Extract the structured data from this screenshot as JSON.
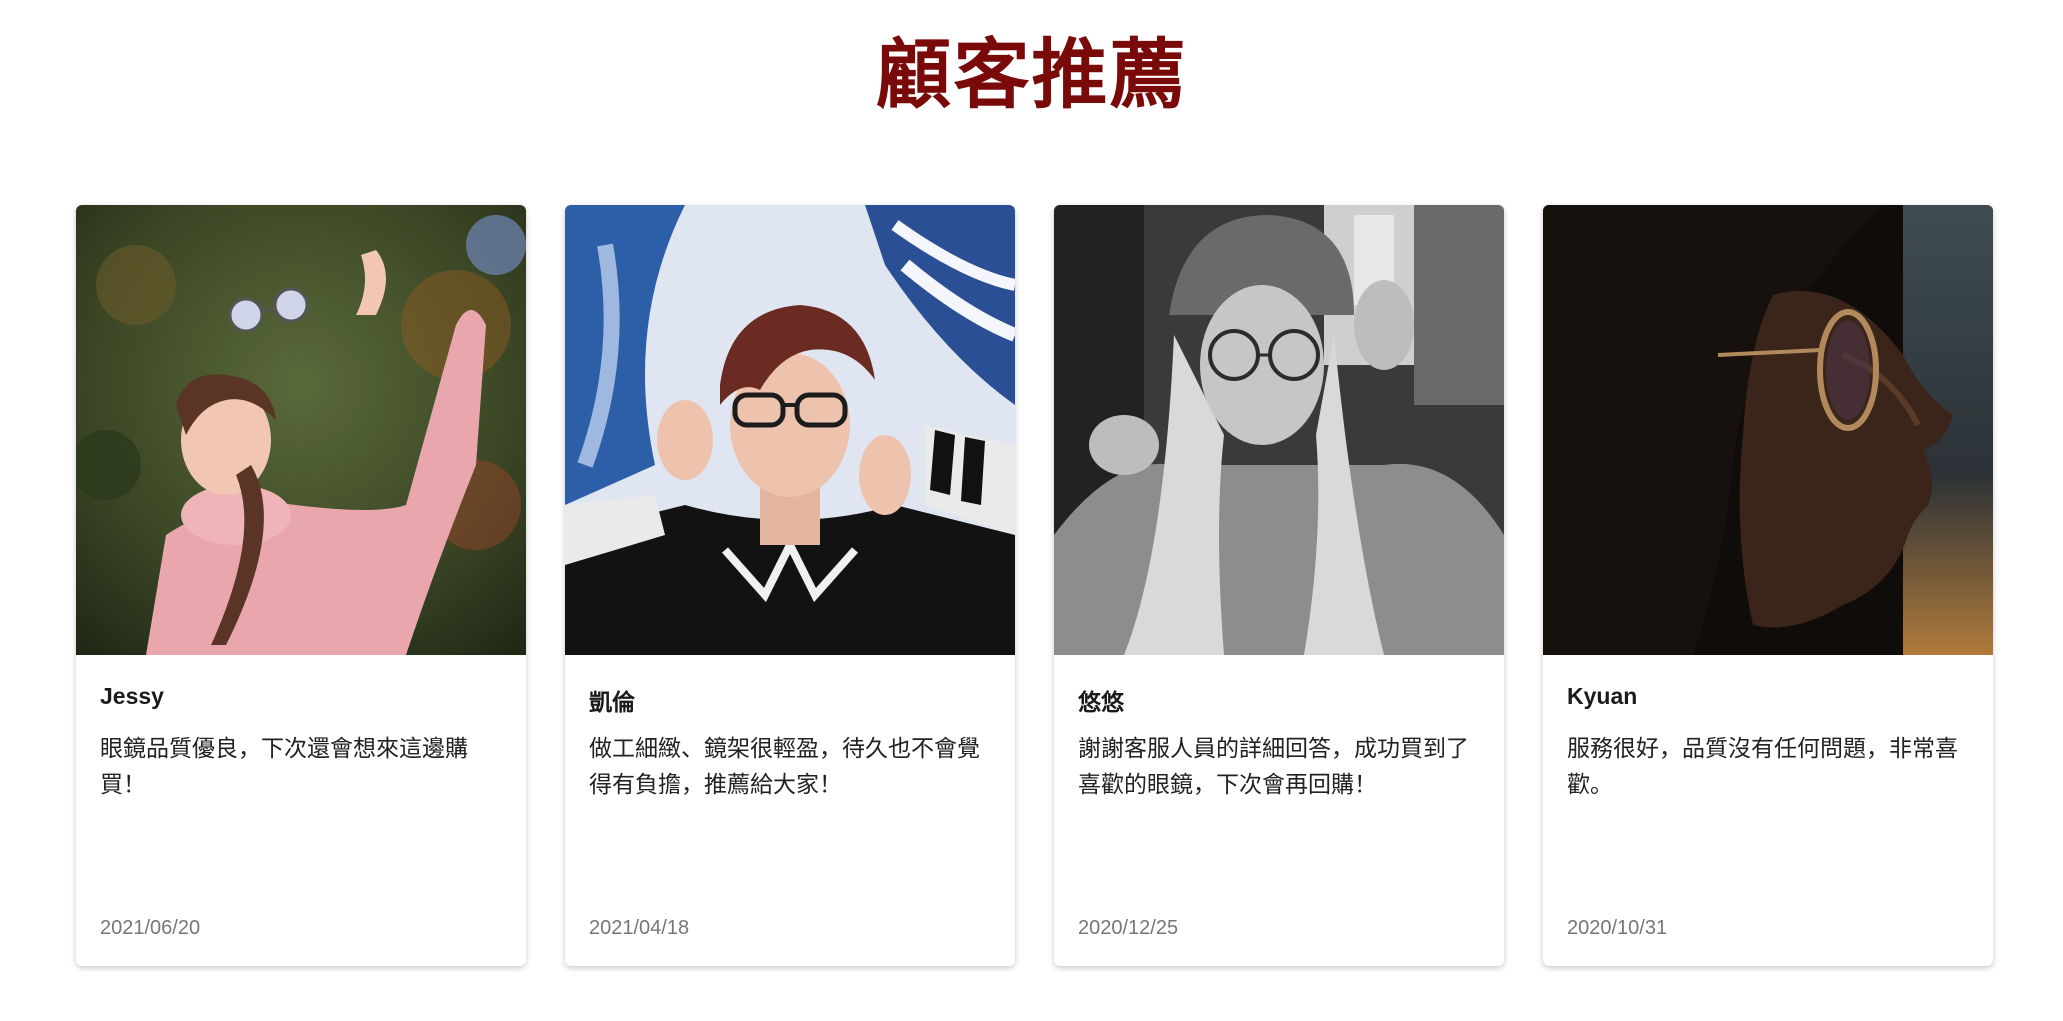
{
  "section": {
    "title": "顧客推薦",
    "title_color": "#7a0a0a"
  },
  "testimonials": [
    {
      "name": "Jessy",
      "text": "眼鏡品質優良，下次還會想來這邊購買！",
      "date": "2021/06/20"
    },
    {
      "name": "凱倫",
      "text": "做工細緻、鏡架很輕盈，待久也不會覺得有負擔，推薦給大家！",
      "date": "2021/04/18"
    },
    {
      "name": "悠悠",
      "text": "謝謝客服人員的詳細回答，成功買到了喜歡的眼鏡，下次會再回購！",
      "date": "2020/12/25"
    },
    {
      "name": "Kyuan",
      "text": "服務很好，品質沒有任何問題，非常喜歡。",
      "date": "2020/10/31"
    }
  ]
}
